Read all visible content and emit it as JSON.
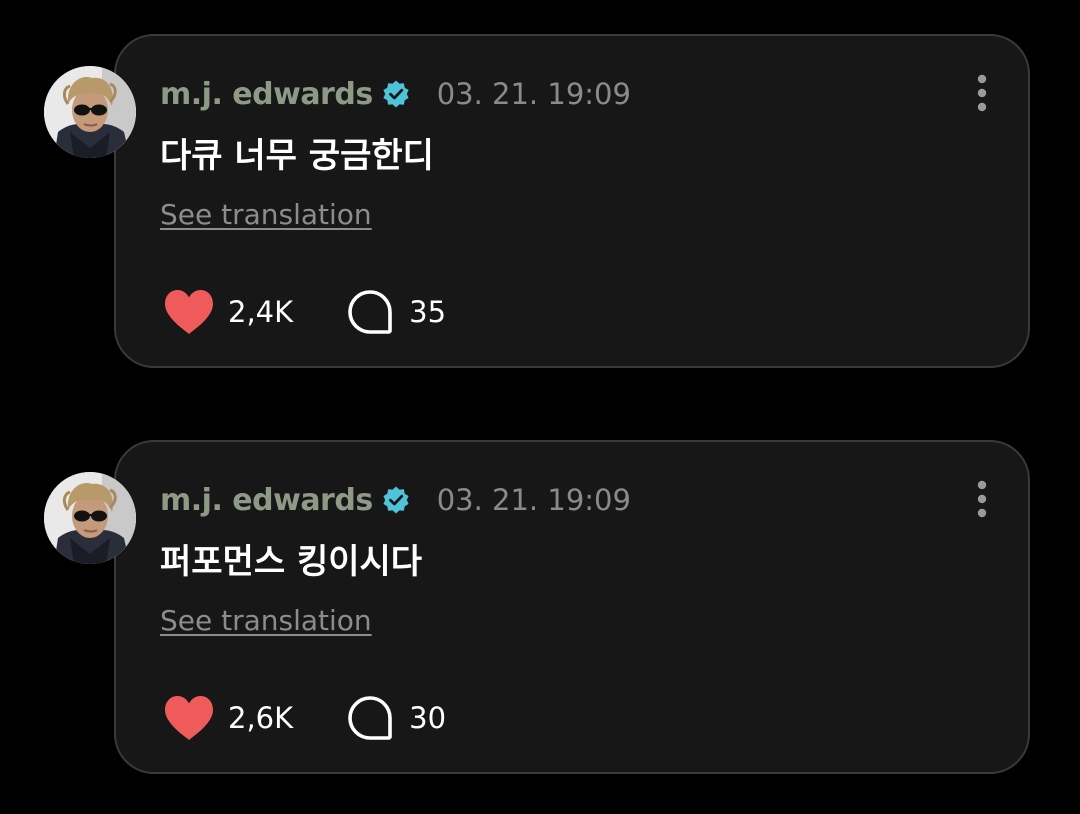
{
  "colors": {
    "background": "#000000",
    "card": "#171717",
    "card_border": "#3a3a3a",
    "username": "#8f9a86",
    "verified": "#4fc3d9",
    "like": "#ef5b5b",
    "secondary_text": "#8a8a8a"
  },
  "posts": [
    {
      "author": "m.j. edwards",
      "verified": true,
      "timestamp": "03. 21. 19:09",
      "text": "다큐 너무 궁금한디",
      "translate_label": "See translation",
      "likes": "2,4K",
      "comments": "35",
      "icons": {
        "like": "heart-icon",
        "comment": "speech-bubble-icon",
        "more": "more-vertical-icon",
        "verified": "verified-badge-icon"
      }
    },
    {
      "author": "m.j. edwards",
      "verified": true,
      "timestamp": "03. 21. 19:09",
      "text": "퍼포먼스 킹이시다",
      "translate_label": "See translation",
      "likes": "2,6K",
      "comments": "30",
      "icons": {
        "like": "heart-icon",
        "comment": "speech-bubble-icon",
        "more": "more-vertical-icon",
        "verified": "verified-badge-icon"
      }
    }
  ]
}
